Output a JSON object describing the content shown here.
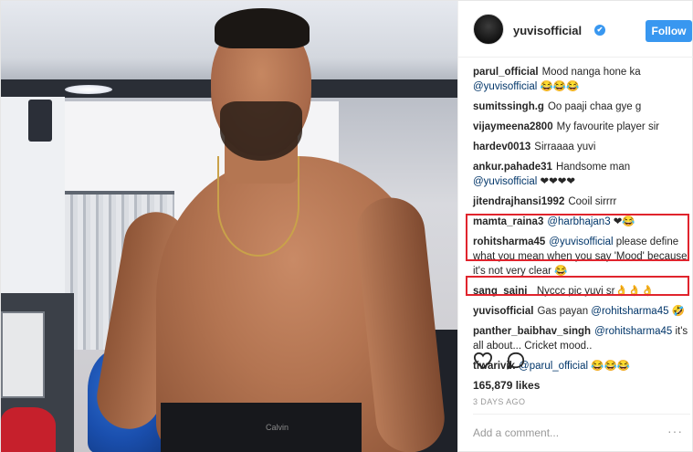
{
  "header": {
    "username": "yuvisofficial",
    "verified": "✔",
    "follow_label": "Follow"
  },
  "comments": [
    {
      "user": "parul_official",
      "parts": [
        {
          "t": "text",
          "v": "Mood nanga hone ka "
        },
        {
          "t": "mention",
          "v": "@yuvisofficial"
        },
        {
          "t": "text",
          "v": " 😂😂😂"
        }
      ]
    },
    {
      "user": "sumitssingh.g",
      "parts": [
        {
          "t": "text",
          "v": "Oo paaji chaa gye g"
        }
      ]
    },
    {
      "user": "vijaymeena2800",
      "parts": [
        {
          "t": "text",
          "v": "My favourite player sir"
        }
      ]
    },
    {
      "user": "hardev0013",
      "parts": [
        {
          "t": "text",
          "v": "Sirraaaa yuvi"
        }
      ]
    },
    {
      "user": "ankur.pahade31",
      "parts": [
        {
          "t": "text",
          "v": "Handsome man "
        },
        {
          "t": "mention",
          "v": "@yuvisofficial"
        },
        {
          "t": "text",
          "v": " ❤❤❤❤"
        }
      ]
    },
    {
      "user": "jitendrajhansi1992",
      "parts": [
        {
          "t": "text",
          "v": "Cooil sirrrr"
        }
      ]
    },
    {
      "user": "mamta_raina3",
      "parts": [
        {
          "t": "mention",
          "v": "@harbhajan3"
        },
        {
          "t": "text",
          "v": " ❤😂"
        }
      ]
    },
    {
      "user": "rohitsharma45",
      "parts": [
        {
          "t": "mention",
          "v": "@yuvisofficial"
        },
        {
          "t": "text",
          "v": " please define what you mean when you say 'Mood' because it's not very clear 😂"
        }
      ]
    },
    {
      "user": "sang_saini_",
      "parts": [
        {
          "t": "text",
          "v": "Nyccc pic yuvi sr👌👌👌"
        }
      ]
    },
    {
      "user": "yuvisofficial",
      "parts": [
        {
          "t": "text",
          "v": "Gas payan "
        },
        {
          "t": "mention",
          "v": "@rohitsharma45"
        },
        {
          "t": "text",
          "v": " 🤣"
        }
      ]
    },
    {
      "user": "panther_baibhav_singh",
      "parts": [
        {
          "t": "mention",
          "v": "@rohitsharma45"
        },
        {
          "t": "text",
          "v": " it's all about... Cricket mood.."
        }
      ]
    },
    {
      "user": "tiwarivik",
      "parts": [
        {
          "t": "mention",
          "v": "@parul_official"
        },
        {
          "t": "text",
          "v": " 😂😂😂"
        }
      ]
    }
  ],
  "likes": "165,879 likes",
  "time": "3 DAYS AGO",
  "add_comment_placeholder": "Add a comment...",
  "more_label": "···",
  "photo": {
    "waistband_text": "Calvin"
  },
  "icons": {
    "like": "heart-icon",
    "comment": "comment-icon"
  },
  "colors": {
    "accent": "#3897f0",
    "highlight": "#e0242d",
    "mention": "#003569"
  }
}
